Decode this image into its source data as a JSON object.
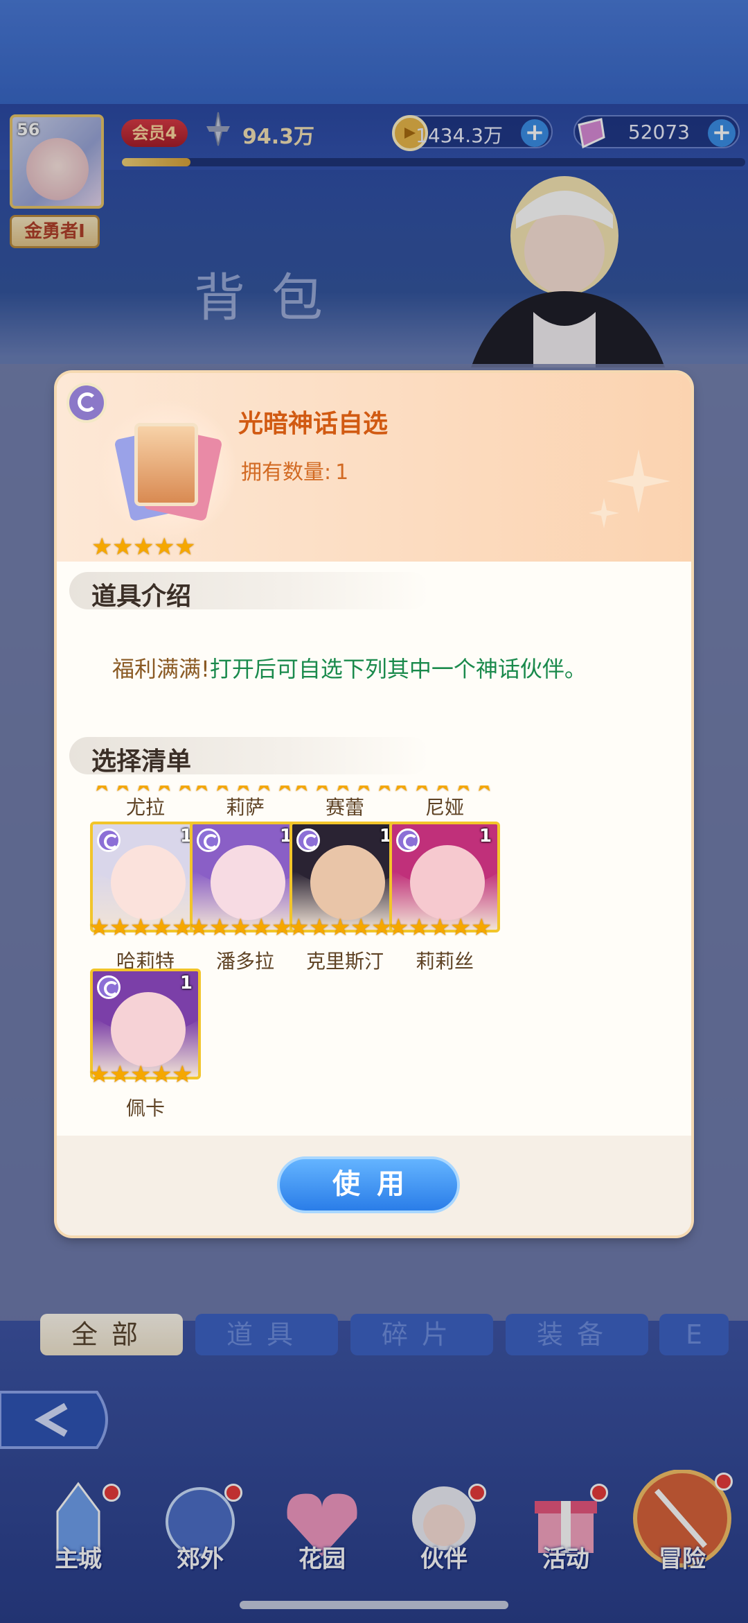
{
  "hud": {
    "level": "56",
    "vip": "会员4",
    "power": "94.3万",
    "name": "金勇者I",
    "gold": "1434.3万",
    "gems": "52073",
    "exp_fraction": 0.11
  },
  "scene": {
    "title": "背包"
  },
  "bag_tabs": [
    "全部",
    "道具",
    "碎片",
    "装备",
    "E"
  ],
  "nav": [
    "主城",
    "郊外",
    "花园",
    "伙伴",
    "活动",
    "冒险"
  ],
  "modal": {
    "item_name": "光暗神话自选",
    "owned_label": "拥有数量:",
    "owned_value": "1",
    "rarity_stars": 5,
    "section_intro": "道具介绍",
    "desc_prefix": "福利满满!",
    "desc_main": "打开后可自选下列其中一个神话伙伴。",
    "section_list": "选择清单",
    "top_row_names": [
      "尤拉",
      "莉萨",
      "赛蕾",
      "尼娅"
    ],
    "heroes": [
      {
        "name": "哈莉特",
        "count": "1",
        "hair": "#d9d6ea",
        "face": "#fbe2dc"
      },
      {
        "name": "潘多拉",
        "count": "1",
        "hair": "#8a5fc6",
        "face": "#f7dbe3"
      },
      {
        "name": "克里斯汀",
        "count": "1",
        "hair": "#2a2333",
        "face": "#e9c5a8"
      },
      {
        "name": "莉莉丝",
        "count": "1",
        "hair": "#c0307a",
        "face": "#f6c9cf"
      },
      {
        "name": "佩卡",
        "count": "1",
        "hair": "#7b3fa8",
        "face": "#f6d2d6"
      }
    ],
    "use_button": "使用"
  },
  "colors": {
    "accent_blue": "#2a7de8",
    "gold_border": "#f2c52a",
    "green_text": "#1a8a4c",
    "title_orange": "#d15a12"
  }
}
